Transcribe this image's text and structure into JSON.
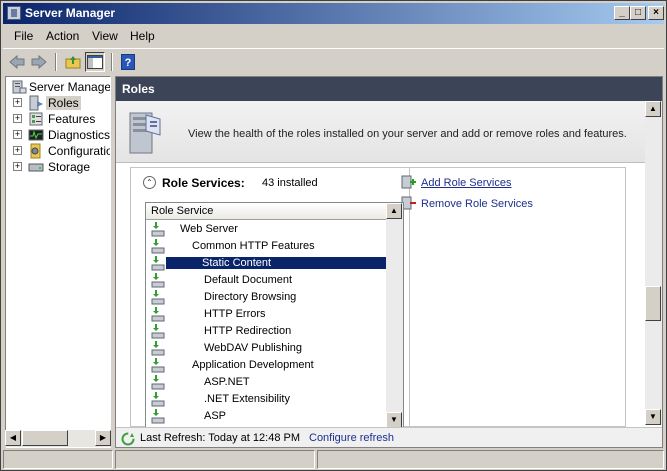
{
  "window": {
    "title": "Server Manager"
  },
  "menu": {
    "file": "File",
    "action": "Action",
    "view": "View",
    "help": "Help"
  },
  "toolbar": {
    "back_icon": "back-arrow-icon",
    "forward_icon": "forward-arrow-icon",
    "up_icon": "up-folder-icon",
    "show_hide_icon": "show-hide-console-tree-icon",
    "help_icon": "help-icon"
  },
  "tree": {
    "root": "Server Manager",
    "items": [
      "Roles",
      "Features",
      "Diagnostics",
      "Configuration",
      "Storage"
    ],
    "selected": "Roles"
  },
  "content": {
    "header": "Roles",
    "intro": "View the health of the roles installed on your server and add or remove roles and features.",
    "role_services": {
      "title": "Role Services:",
      "count": "43 installed",
      "column_header": "Role Service",
      "rows": [
        {
          "label": "Web Server",
          "level": 0
        },
        {
          "label": "Common HTTP Features",
          "level": 1
        },
        {
          "label": "Static Content",
          "level": 2,
          "selected": true
        },
        {
          "label": "Default Document",
          "level": 2
        },
        {
          "label": "Directory Browsing",
          "level": 2
        },
        {
          "label": "HTTP Errors",
          "level": 2
        },
        {
          "label": "HTTP Redirection",
          "level": 2
        },
        {
          "label": "WebDAV Publishing",
          "level": 2
        },
        {
          "label": "Application Development",
          "level": 1
        },
        {
          "label": "ASP.NET",
          "level": 2
        },
        {
          "label": ".NET Extensibility",
          "level": 2
        },
        {
          "label": "ASP",
          "level": 2
        }
      ]
    },
    "actions": {
      "add": "Add Role Services",
      "remove": "Remove Role Services"
    }
  },
  "footer": {
    "last_refresh": "Last Refresh: Today at 12:48 PM",
    "configure": "Configure refresh"
  },
  "colors": {
    "title_start": "#0a246a",
    "title_end": "#a6caf0",
    "header_bg": "#3c4458",
    "link": "#1c2f8f",
    "selection": "#0a246a"
  }
}
